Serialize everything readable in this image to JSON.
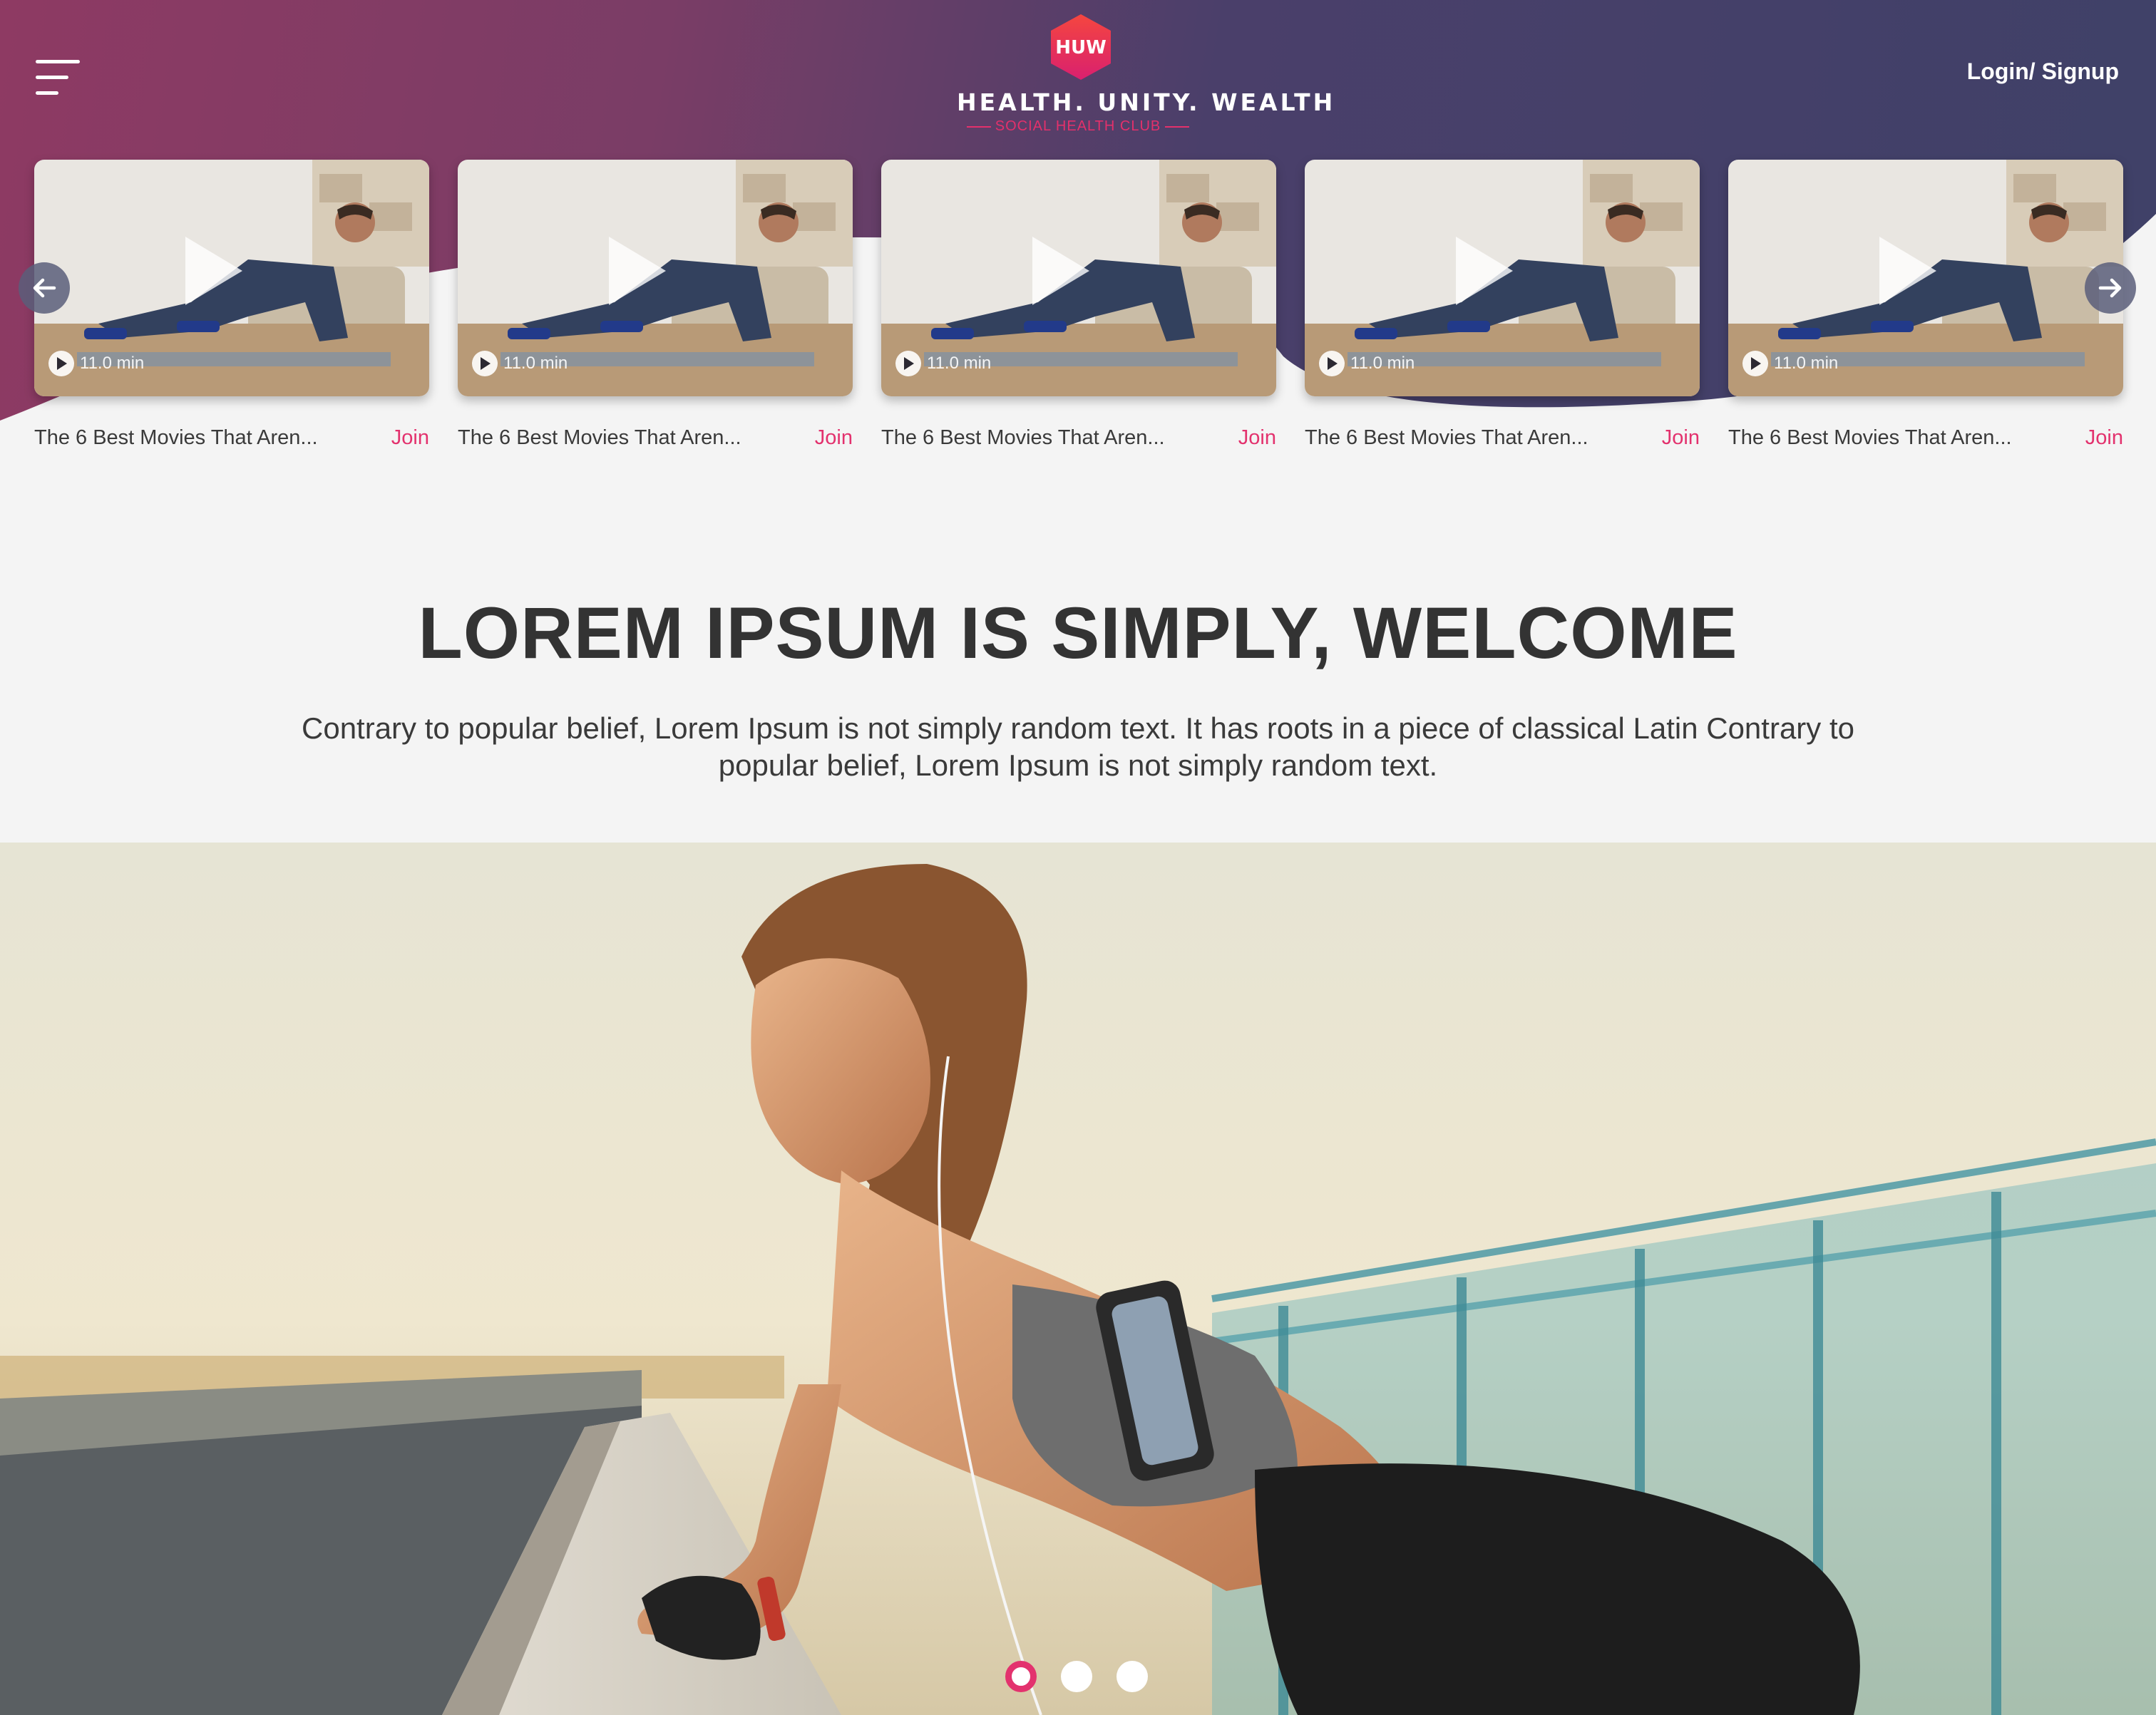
{
  "header": {
    "login_label": "Login/ Signup",
    "logo_badge_text": "HUW",
    "logo_main": "HEALTH. UNITY. WEALTH",
    "logo_sub": "SOCIAL HEALTH CLUB"
  },
  "carousel": {
    "cards": [
      {
        "title": "The 6 Best Movies That Aren...",
        "duration": "11.0 min",
        "join_label": "Join"
      },
      {
        "title": "The 6 Best Movies That Aren...",
        "duration": "11.0 min",
        "join_label": "Join"
      },
      {
        "title": "The 6 Best Movies That Aren...",
        "duration": "11.0 min",
        "join_label": "Join"
      },
      {
        "title": "The 6 Best Movies That Aren...",
        "duration": "11.0 min",
        "join_label": "Join"
      },
      {
        "title": "The 6 Best Movies That Aren...",
        "duration": "11.0 min",
        "join_label": "Join"
      }
    ]
  },
  "welcome": {
    "title": "LOREM IPSUM IS SIMPLY, WELCOME",
    "text": "Contrary to popular belief, Lorem Ipsum is not simply random text. It has roots in a piece of classical Latin Contrary to popular belief, Lorem Ipsum is not simply random text."
  },
  "banner": {
    "slide_count": 3,
    "active_slide": 1
  },
  "colors": {
    "accent": "#e3326e",
    "header_start": "#8e3a63",
    "header_end": "#3f4168",
    "background": "#f4f4f4"
  }
}
